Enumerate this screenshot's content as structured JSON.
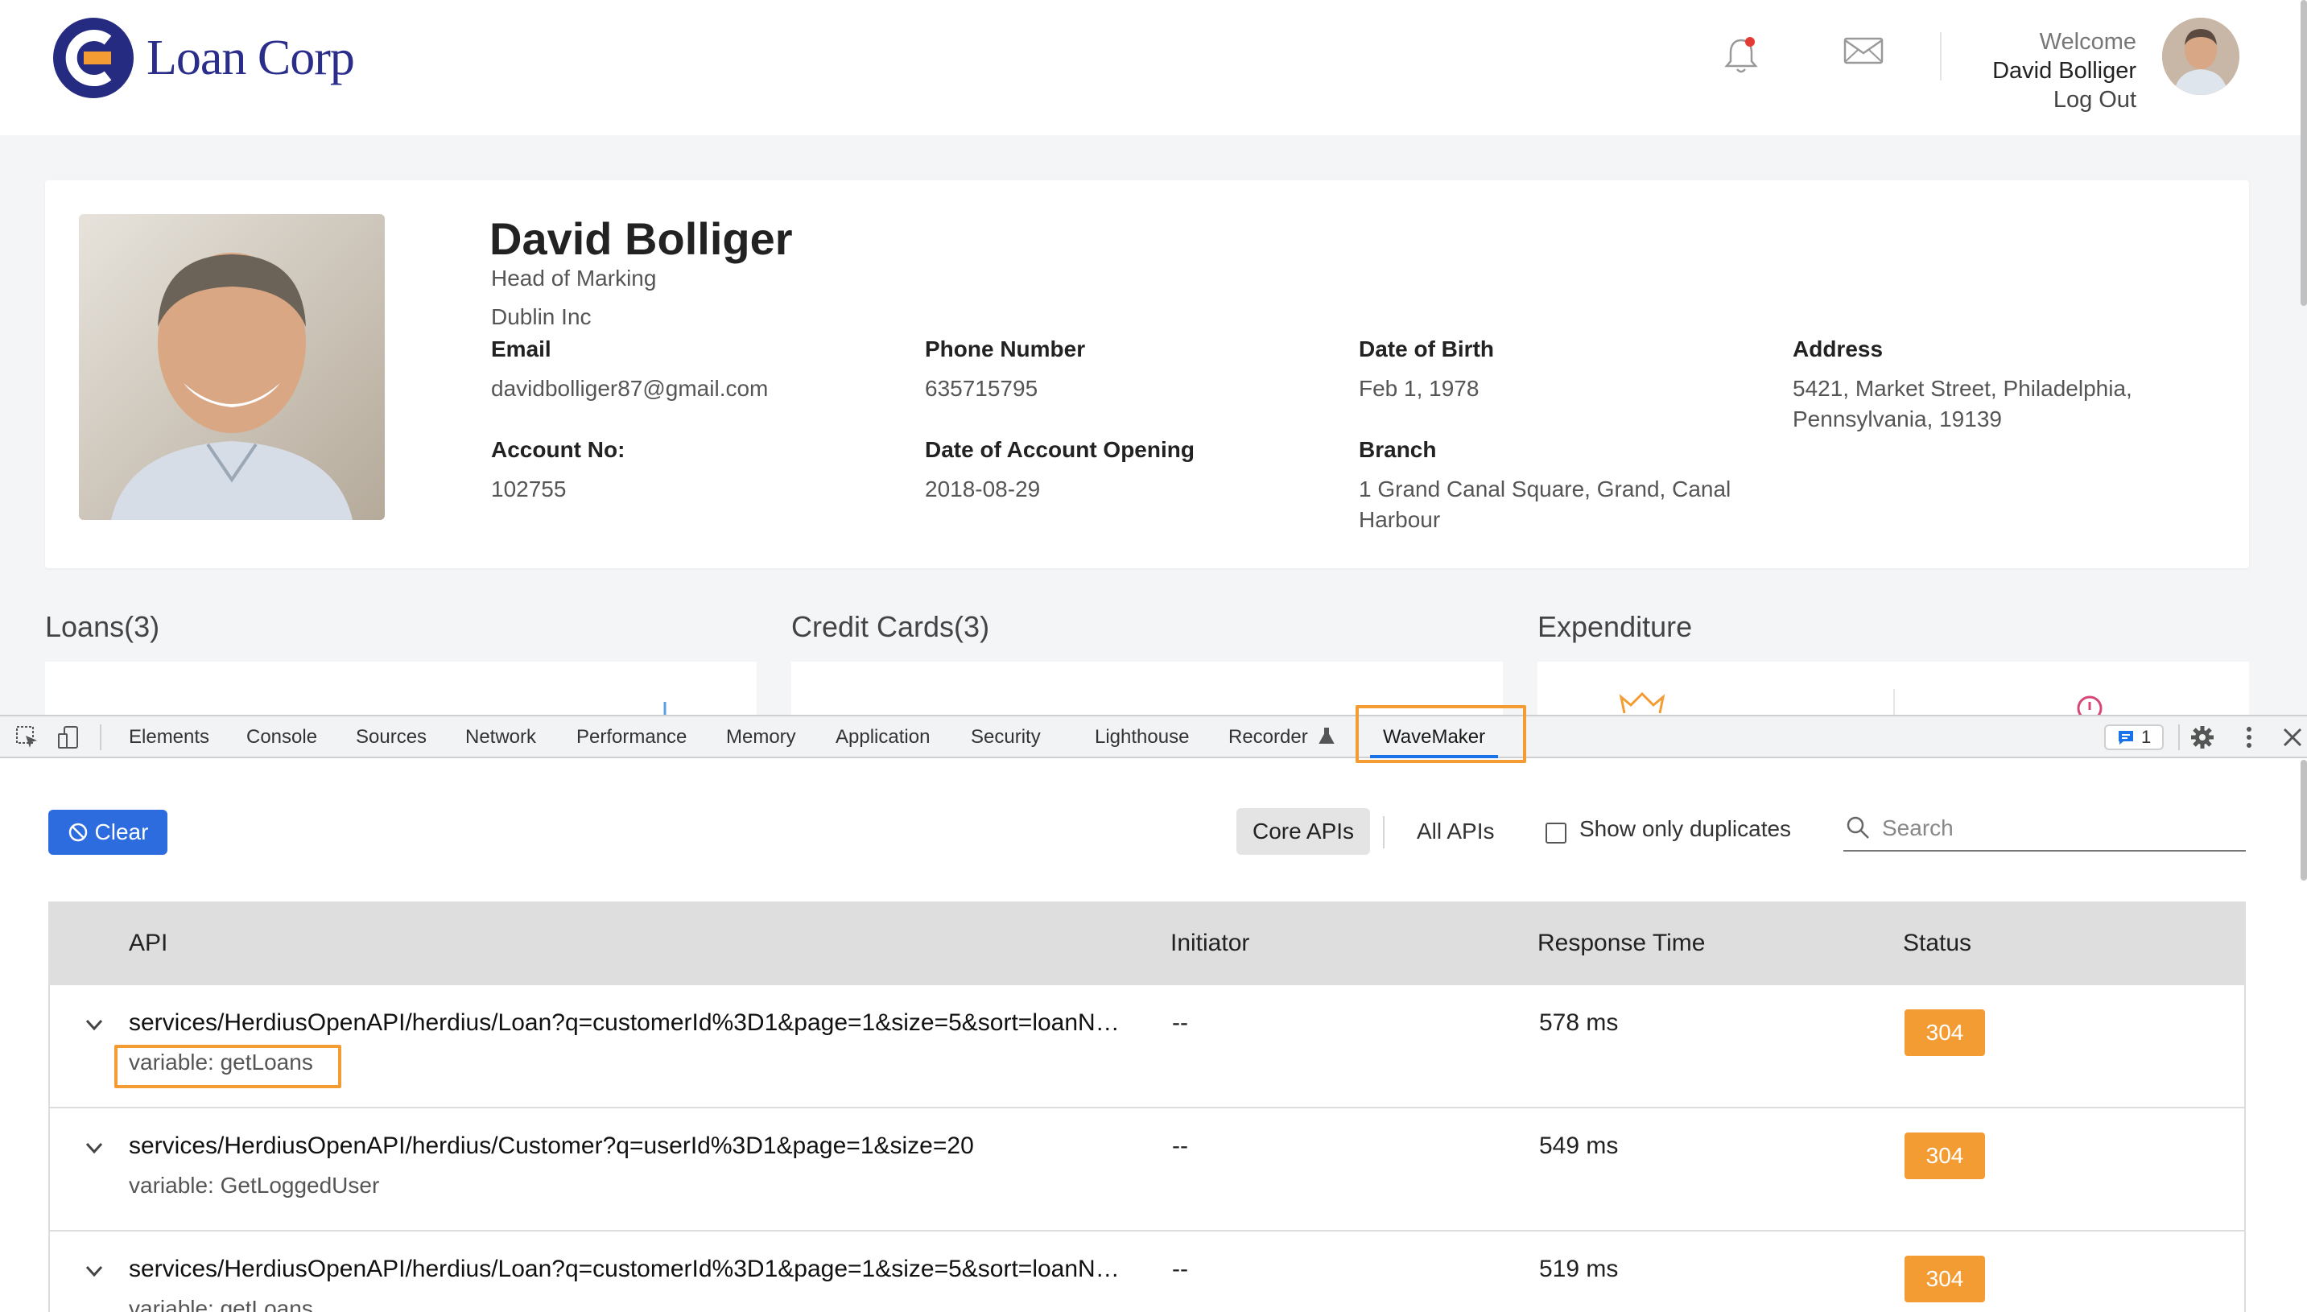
{
  "header": {
    "brand": "Loan Corp",
    "welcome": "Welcome",
    "user_name": "David Bolliger",
    "logout": "Log Out"
  },
  "profile": {
    "name": "David Bolliger",
    "role": "Head of Marking",
    "company": "Dublin Inc",
    "fields": {
      "email": {
        "label": "Email",
        "value": "davidbolliger87@gmail.com"
      },
      "phone": {
        "label": "Phone Number",
        "value": "635715795"
      },
      "dob": {
        "label": "Date of Birth",
        "value": "Feb 1, 1978"
      },
      "address": {
        "label": "Address",
        "value": "5421, Market Street, Philadelphia, Pennsylvania, 19139"
      },
      "account_no": {
        "label": "Account No:",
        "value": "102755"
      },
      "opening": {
        "label": "Date of Account Opening",
        "value": "2018-08-29"
      },
      "branch": {
        "label": "Branch",
        "value": "1 Grand Canal Square, Grand, Canal Harbour"
      }
    }
  },
  "sections": {
    "loans": "Loans(3)",
    "credit_cards": "Credit Cards(3)",
    "expenditure": "Expenditure"
  },
  "devtools": {
    "tabs": [
      "Elements",
      "Console",
      "Sources",
      "Network",
      "Performance",
      "Memory",
      "Application",
      "Security",
      "Lighthouse",
      "Recorder",
      "WaveMaker"
    ],
    "active_tab": "WaveMaker",
    "issues_count": "1",
    "toolbar": {
      "clear_label": "Clear",
      "core_apis": "Core APIs",
      "all_apis": "All APIs",
      "duplicates_label": "Show only duplicates",
      "search_placeholder": "Search"
    },
    "table": {
      "headers": {
        "api": "API",
        "initiator": "Initiator",
        "response_time": "Response Time",
        "status": "Status"
      },
      "rows": [
        {
          "api": "services/HerdiusOpenAPI/herdius/Loan?q=customerId%3D1&page=1&size=5&sort=loanN…",
          "variable": "variable: getLoans",
          "initiator": "--",
          "response_time": "578 ms",
          "status": "304"
        },
        {
          "api": "services/HerdiusOpenAPI/herdius/Customer?q=userId%3D1&page=1&size=20",
          "variable": "variable: GetLoggedUser",
          "initiator": "--",
          "response_time": "549 ms",
          "status": "304"
        },
        {
          "api": "services/HerdiusOpenAPI/herdius/Loan?q=customerId%3D1&page=1&size=5&sort=loanN…",
          "variable": "variable: getLoans",
          "initiator": "--",
          "response_time": "519 ms",
          "status": "304"
        }
      ]
    }
  },
  "colors": {
    "brand_navy": "#2a2e8a",
    "brand_orange": "#f39c33",
    "primary_button": "#2d6cdf",
    "status_badge": "#f39c33",
    "highlight": "#f39c33"
  }
}
